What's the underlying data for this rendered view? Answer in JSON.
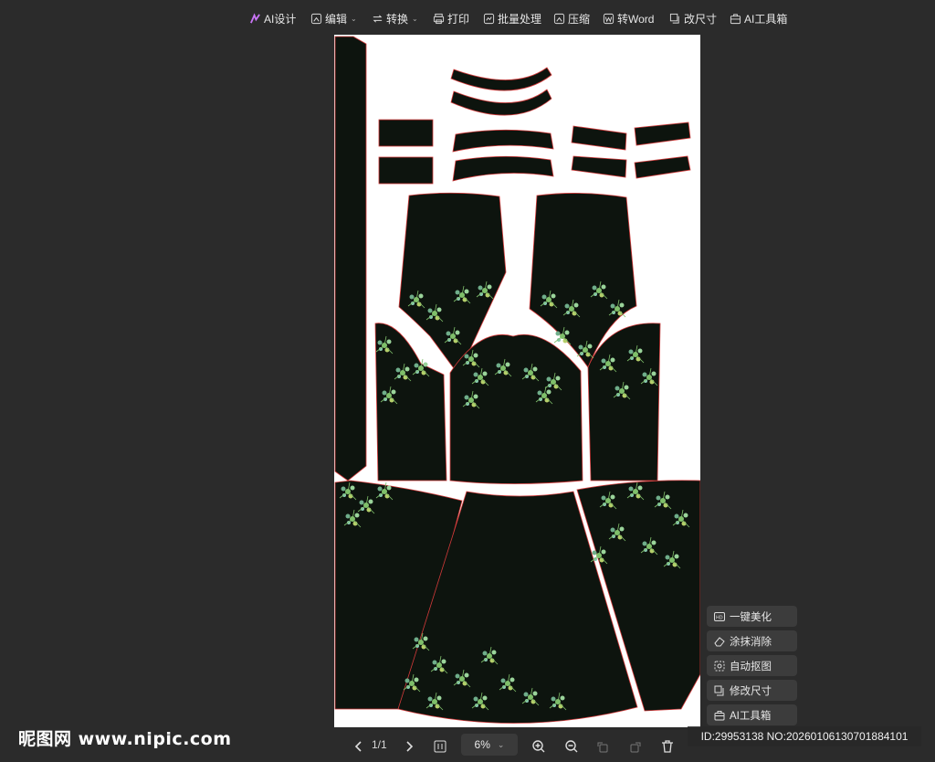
{
  "toolbar": {
    "items": [
      {
        "label": "AI设计",
        "icon": "ai-design-icon"
      },
      {
        "label": "编辑",
        "icon": "edit-icon",
        "has_dropdown": true
      },
      {
        "label": "转换",
        "icon": "convert-icon",
        "has_dropdown": true
      },
      {
        "label": "打印",
        "icon": "printer-icon"
      },
      {
        "label": "批量处理",
        "icon": "batch-icon"
      },
      {
        "label": "压缩",
        "icon": "compress-icon"
      },
      {
        "label": "转Word",
        "icon": "word-icon"
      },
      {
        "label": "改尺寸",
        "icon": "resize-icon"
      },
      {
        "label": "AI工具箱",
        "icon": "toolbox-icon"
      }
    ]
  },
  "side_panel": {
    "items": [
      {
        "label": "一键美化",
        "icon": "hd-icon"
      },
      {
        "label": "涂抹消除",
        "icon": "eraser-icon"
      },
      {
        "label": "自动抠图",
        "icon": "cutout-icon"
      },
      {
        "label": "修改尺寸",
        "icon": "resize-icon"
      },
      {
        "label": "AI工具箱",
        "icon": "toolbox-icon"
      }
    ]
  },
  "bottom_bar": {
    "page_indicator": "1/1",
    "zoom": "6%"
  },
  "watermark": {
    "site": "昵图网 www.nipic.com",
    "id_text": "ID:29953138 NO:20260106130701884101"
  },
  "colors": {
    "background": "#2b2b2b",
    "garment_fill": "#0d140e",
    "cut_line": "#d23a3a",
    "floral_green": "#7fbf6a"
  }
}
